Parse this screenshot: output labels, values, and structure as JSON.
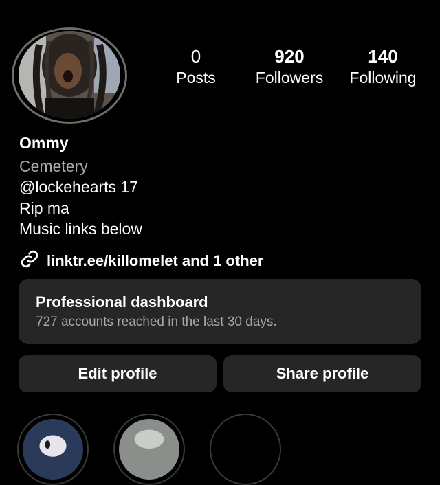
{
  "profile": {
    "name": "Ommy",
    "category": "Cemetery",
    "bio_line_1": "@lockehearts 17",
    "bio_line_2": "Rip ma",
    "bio_line_3": "Music links below",
    "link_text": "linktr.ee/killomelet and 1 other"
  },
  "stats": {
    "posts_count": "0",
    "posts_label": "Posts",
    "followers_count": "920",
    "followers_label": "Followers",
    "following_count": "140",
    "following_label": "Following"
  },
  "dashboard": {
    "title": "Professional dashboard",
    "subtitle": "727 accounts reached in the last 30 days."
  },
  "buttons": {
    "edit": "Edit profile",
    "share": "Share profile"
  },
  "icons": {
    "link": "link-icon"
  },
  "colors": {
    "background": "#000000",
    "card": "#262626",
    "secondary_text": "#a8a8a8"
  }
}
